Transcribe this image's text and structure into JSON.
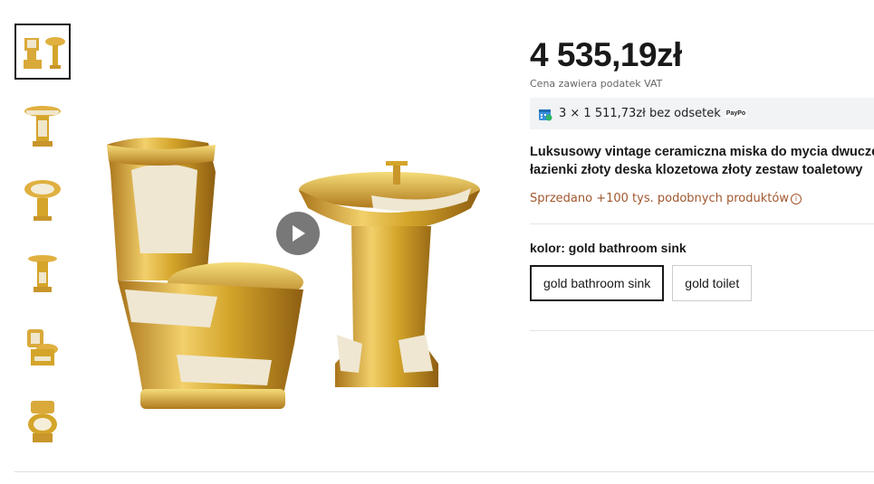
{
  "gallery": {
    "thumbnails": [
      {
        "name": "toilet-and-sink-set"
      },
      {
        "name": "bathroom-sink"
      },
      {
        "name": "sink-top-view"
      },
      {
        "name": "sink-pedestal"
      },
      {
        "name": "toilet-open-lid"
      },
      {
        "name": "toilet-seat"
      }
    ],
    "play_icon": "play-icon"
  },
  "product": {
    "price": "4 535,19zł",
    "vat_note": "Cena zawiera podatek VAT",
    "installments": "3 × 1 511,73zł bez odsetek",
    "installments_logo": "PayPo",
    "title_line1": "Luksusowy vintage ceramiczna miska do mycia dwuczę",
    "title_line2": "łazienki złoty deska klozetowa złoty zestaw toaletowy",
    "sold": "Sprzedano +100 tys. podobnych produktów",
    "color_label": "kolor: gold bathroom sink",
    "color_options": [
      "gold bathroom sink",
      "gold toilet"
    ],
    "selected_color": "gold bathroom sink"
  },
  "colors": {
    "accent": "#191919",
    "sold": "#a0572e",
    "paypo_bg": "#f2f3f5",
    "gold": "#d4a52a"
  }
}
